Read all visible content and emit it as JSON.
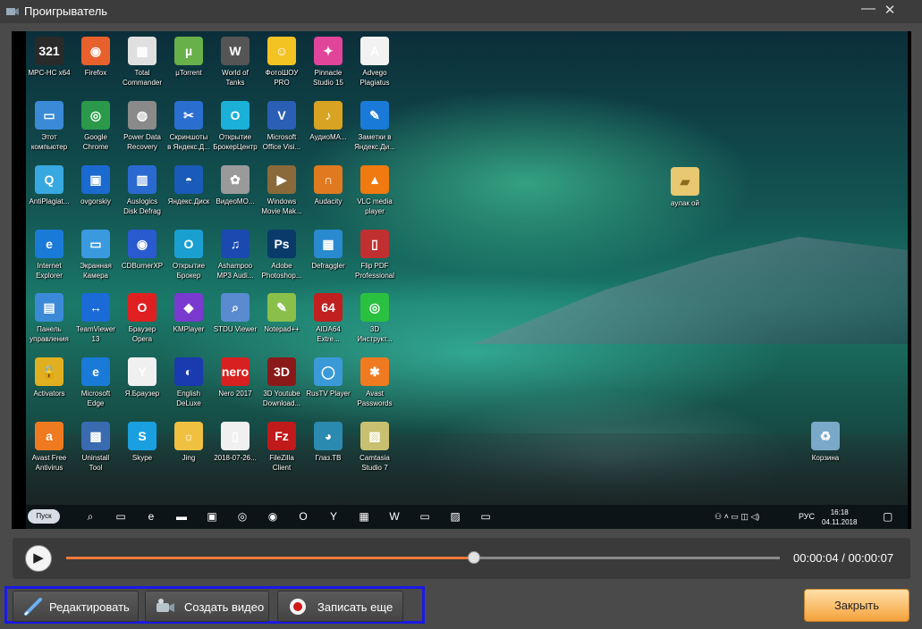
{
  "window": {
    "title": "Проигрыватель",
    "minimize_glyph": "—",
    "close_glyph": "✕"
  },
  "desktop": {
    "icons": [
      {
        "label": "MPC-HC x64",
        "glyph": "321",
        "color": "#2a2a2a"
      },
      {
        "label": "Firefox",
        "glyph": "◉",
        "color": "#e8612c"
      },
      {
        "label": "Total\nCommander",
        "glyph": "▦",
        "color": "#e0e0e0"
      },
      {
        "label": "µTorrent",
        "glyph": "µ",
        "color": "#68b04a"
      },
      {
        "label": "World of\nTanks",
        "glyph": "W",
        "color": "#555"
      },
      {
        "label": "ФотоШОУ\nPRO",
        "glyph": "☺",
        "color": "#f3c223"
      },
      {
        "label": "Pinnacle\nStudio 15",
        "glyph": "✦",
        "color": "#e0459a"
      },
      {
        "label": "Advego\nPlagiatus",
        "glyph": "A",
        "color": "#f2f2f2"
      },
      {
        "label": "Этот\nкомпьютер",
        "glyph": "▭",
        "color": "#3a8ad8"
      },
      {
        "label": "Google\nChrome",
        "glyph": "◎",
        "color": "#2a9a4a"
      },
      {
        "label": "Power Data\nRecovery",
        "glyph": "◍",
        "color": "#8a8a8a"
      },
      {
        "label": "Скриншоты\nв Яндекс.Д...",
        "glyph": "✂",
        "color": "#2a6fd0"
      },
      {
        "label": "Открытие\nБрокерЦентр",
        "glyph": "O",
        "color": "#1ab0d8"
      },
      {
        "label": "Microsoft\nOffice Visi...",
        "glyph": "V",
        "color": "#2a5fb5"
      },
      {
        "label": "АудиоМА...",
        "glyph": "♪",
        "color": "#d8a322"
      },
      {
        "label": "Заметки в\nЯндекс.Ди...",
        "glyph": "✎",
        "color": "#1a7ad8"
      },
      {
        "label": "AntiPlagiat...",
        "glyph": "Q",
        "color": "#38a8e0"
      },
      {
        "label": "ovgorskiy",
        "glyph": "▣",
        "color": "#1a6ad0"
      },
      {
        "label": "Auslogics\nDisk Defrag",
        "glyph": "▥",
        "color": "#2a6ad0"
      },
      {
        "label": "Яндекс.Диск",
        "glyph": "◓",
        "color": "#1a5ab8"
      },
      {
        "label": "ВидеоМО...",
        "glyph": "✿",
        "color": "#9a9a9a"
      },
      {
        "label": "Windows\nMovie Mak...",
        "glyph": "▶",
        "color": "#8a6a3a"
      },
      {
        "label": "Audacity",
        "glyph": "∩",
        "color": "#e07a20"
      },
      {
        "label": "VLC media\nplayer",
        "glyph": "▲",
        "color": "#f07a10"
      },
      {
        "label": "Internet\nExplorer",
        "glyph": "e",
        "color": "#1a7ad8"
      },
      {
        "label": "Экранная\nКамера",
        "glyph": "▭",
        "color": "#3a9ae0"
      },
      {
        "label": "CDBurnerXP",
        "glyph": "◉",
        "color": "#2a5ad0"
      },
      {
        "label": "Открытие\nБрокер",
        "glyph": "O",
        "color": "#1aa0d0"
      },
      {
        "label": "Ashampoo\nMP3 Audi...",
        "glyph": "♫",
        "color": "#1a4ab0"
      },
      {
        "label": "Adobe\nPhotoshop...",
        "glyph": "Ps",
        "color": "#0a3a6a"
      },
      {
        "label": "Defraggler",
        "glyph": "▦",
        "color": "#2a8ad0"
      },
      {
        "label": "Flip PDF\nProfessional",
        "glyph": "▯",
        "color": "#c03030"
      },
      {
        "label": "Панель\nуправления",
        "glyph": "▤",
        "color": "#3a8ad8"
      },
      {
        "label": "TeamViewer\n13",
        "glyph": "↔",
        "color": "#1a6ad8"
      },
      {
        "label": "Браузер\nOpera",
        "glyph": "O",
        "color": "#e02020"
      },
      {
        "label": "KMPlayer",
        "glyph": "◆",
        "color": "#7a3ad0"
      },
      {
        "label": "STDU Viewer",
        "glyph": "⌕",
        "color": "#5a8ad0"
      },
      {
        "label": "Notepad++",
        "glyph": "✎",
        "color": "#8ac04a"
      },
      {
        "label": "AIDA64\nExtre...",
        "glyph": "64",
        "color": "#c02020"
      },
      {
        "label": "3D\nИнструкт...",
        "glyph": "◎",
        "color": "#2ac040"
      },
      {
        "label": "Activators",
        "glyph": "🔒",
        "color": "#e0b020"
      },
      {
        "label": "Microsoft\nEdge",
        "glyph": "e",
        "color": "#1a7ad8"
      },
      {
        "label": "Я.Браузер",
        "glyph": "Y",
        "color": "#f0f0f0"
      },
      {
        "label": "English\nDeLuxe",
        "glyph": "◐",
        "color": "#1a3ab0"
      },
      {
        "label": "Nero 2017",
        "glyph": "nero",
        "color": "#d82020"
      },
      {
        "label": "3D Youtube\nDownload...",
        "glyph": "3D",
        "color": "#8a1a1a"
      },
      {
        "label": "RusTV Player",
        "glyph": "◯",
        "color": "#3a9ad8"
      },
      {
        "label": "Avast\nPasswords",
        "glyph": "✱",
        "color": "#f07a20"
      },
      {
        "label": "Avast Free\nAntivirus",
        "glyph": "a",
        "color": "#f07a20"
      },
      {
        "label": "Uninstall\nTool",
        "glyph": "▩",
        "color": "#3a6ab0"
      },
      {
        "label": "Skype",
        "glyph": "S",
        "color": "#1aa0e0"
      },
      {
        "label": "Jing",
        "glyph": "☼",
        "color": "#f0c040"
      },
      {
        "label": "2018-07-26...",
        "glyph": "▯",
        "color": "#f0f0f0"
      },
      {
        "label": "FileZilla\nClient",
        "glyph": "Fz",
        "color": "#c01a1a"
      },
      {
        "label": "Глаз.ТВ",
        "glyph": "◕",
        "color": "#2a8ab0"
      },
      {
        "label": "Camtasia\nStudio 7",
        "glyph": "▨",
        "color": "#c8c070"
      }
    ],
    "folder_icon": {
      "label": "аулак ой",
      "glyph": "▰",
      "color": "#e8c870"
    },
    "recycle_icon": {
      "label": "Корзина",
      "glyph": "♻",
      "color": "#7aa8c8"
    },
    "taskbar": {
      "start_label": "Пуск",
      "items": [
        "⌕",
        "▭",
        "e",
        "▬",
        "▣",
        "◎",
        "◉",
        "O",
        "Y",
        "▦",
        "W",
        "▭",
        "▨",
        "▭"
      ],
      "tray": "⚇ ˄ ▭ ◫ ◁)",
      "lang": "РУС",
      "time": "16:18",
      "date": "04.11.2018",
      "notify_glyph": "▢"
    }
  },
  "player": {
    "play_glyph": "▶",
    "progress": 0.5714,
    "current_time": "00:00:04",
    "total_time": "00:00:07",
    "separator": "/",
    "accent": "#f07a3a"
  },
  "actions": {
    "edit_label": "Редактировать",
    "create_video_label": "Создать видео",
    "record_more_label": "Записать еще",
    "close_label": "Закрыть"
  }
}
